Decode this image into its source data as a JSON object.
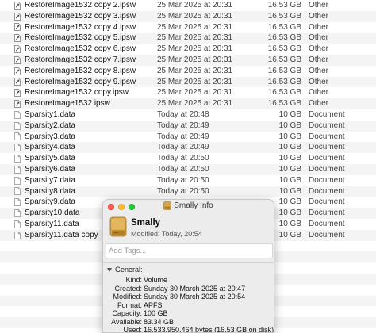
{
  "finder": {
    "rows": [
      {
        "name": "RestoreImage1532 copy 2.ipsw",
        "date": "25 Mar 2025 at 20:31",
        "size": "16.53 GB",
        "kind": "Other",
        "icon": "ipsw-file-icon"
      },
      {
        "name": "RestoreImage1532 copy 3.ipsw",
        "date": "25 Mar 2025 at 20:31",
        "size": "16.53 GB",
        "kind": "Other",
        "icon": "ipsw-file-icon"
      },
      {
        "name": "RestoreImage1532 copy 4.ipsw",
        "date": "25 Mar 2025 at 20:31",
        "size": "16.53 GB",
        "kind": "Other",
        "icon": "ipsw-file-icon"
      },
      {
        "name": "RestoreImage1532 copy 5.ipsw",
        "date": "25 Mar 2025 at 20:31",
        "size": "16.53 GB",
        "kind": "Other",
        "icon": "ipsw-file-icon"
      },
      {
        "name": "RestoreImage1532 copy 6.ipsw",
        "date": "25 Mar 2025 at 20:31",
        "size": "16.53 GB",
        "kind": "Other",
        "icon": "ipsw-file-icon"
      },
      {
        "name": "RestoreImage1532 copy 7.ipsw",
        "date": "25 Mar 2025 at 20:31",
        "size": "16.53 GB",
        "kind": "Other",
        "icon": "ipsw-file-icon"
      },
      {
        "name": "RestoreImage1532 copy 8.ipsw",
        "date": "25 Mar 2025 at 20:31",
        "size": "16.53 GB",
        "kind": "Other",
        "icon": "ipsw-file-icon"
      },
      {
        "name": "RestoreImage1532 copy 9.ipsw",
        "date": "25 Mar 2025 at 20:31",
        "size": "16.53 GB",
        "kind": "Other",
        "icon": "ipsw-file-icon"
      },
      {
        "name": "RestoreImage1532 copy.ipsw",
        "date": "25 Mar 2025 at 20:31",
        "size": "16.53 GB",
        "kind": "Other",
        "icon": "ipsw-file-icon"
      },
      {
        "name": "RestoreImage1532.ipsw",
        "date": "25 Mar 2025 at 20:31",
        "size": "16.53 GB",
        "kind": "Other",
        "icon": "ipsw-file-icon"
      },
      {
        "name": "Sparsity1.data",
        "date": "Today at 20:48",
        "size": "10 GB",
        "kind": "Document",
        "icon": "document-icon"
      },
      {
        "name": "Sparsity2.data",
        "date": "Today at 20:49",
        "size": "10 GB",
        "kind": "Document",
        "icon": "document-icon"
      },
      {
        "name": "Sparsity3.data",
        "date": "Today at 20:49",
        "size": "10 GB",
        "kind": "Document",
        "icon": "document-icon"
      },
      {
        "name": "Sparsity4.data",
        "date": "Today at 20:49",
        "size": "10 GB",
        "kind": "Document",
        "icon": "document-icon"
      },
      {
        "name": "Sparsity5.data",
        "date": "Today at 20:50",
        "size": "10 GB",
        "kind": "Document",
        "icon": "document-icon"
      },
      {
        "name": "Sparsity6.data",
        "date": "Today at 20:50",
        "size": "10 GB",
        "kind": "Document",
        "icon": "document-icon"
      },
      {
        "name": "Sparsity7.data",
        "date": "Today at 20:50",
        "size": "10 GB",
        "kind": "Document",
        "icon": "document-icon"
      },
      {
        "name": "Sparsity8.data",
        "date": "Today at 20:50",
        "size": "10 GB",
        "kind": "Document",
        "icon": "document-icon"
      },
      {
        "name": "Sparsity9.data",
        "date": "",
        "size": "10 GB",
        "kind": "Document",
        "icon": "document-icon"
      },
      {
        "name": "Sparsity10.data",
        "date": "",
        "size": "10 GB",
        "kind": "Document",
        "icon": "document-icon"
      },
      {
        "name": "Sparsity11.data",
        "date": "",
        "size": "10 GB",
        "kind": "Document",
        "icon": "document-icon"
      },
      {
        "name": "Sparsity11.data copy",
        "date": "",
        "size": "10 GB",
        "kind": "Document",
        "icon": "document-icon"
      },
      {
        "name": "",
        "date": "",
        "size": "",
        "kind": "",
        "icon": ""
      },
      {
        "name": "",
        "date": "",
        "size": "",
        "kind": "",
        "icon": ""
      },
      {
        "name": "",
        "date": "",
        "size": "",
        "kind": "",
        "icon": ""
      },
      {
        "name": "",
        "date": "",
        "size": "",
        "kind": "",
        "icon": ""
      },
      {
        "name": "",
        "date": "",
        "size": "",
        "kind": "",
        "icon": ""
      },
      {
        "name": "",
        "date": "",
        "size": "",
        "kind": "",
        "icon": ""
      },
      {
        "name": "",
        "date": "",
        "size": "",
        "kind": "",
        "icon": ""
      },
      {
        "name": "",
        "date": "",
        "size": "",
        "kind": "",
        "icon": ""
      },
      {
        "name": "",
        "date": "",
        "size": "",
        "kind": "",
        "icon": ""
      }
    ]
  },
  "info": {
    "window_title": "Smally Info",
    "volume_name": "Smally",
    "modified_line": "Modified: Today, 20:54",
    "tags_placeholder": "Add Tags...",
    "section_general": "General:",
    "fields": [
      {
        "key": "Kind:",
        "value": "Volume"
      },
      {
        "key": "Created:",
        "value": "Sunday 30 March 2025 at 20:47"
      },
      {
        "key": "Modified:",
        "value": "Sunday 30 March 2025 at 20:54"
      },
      {
        "key": "Format:",
        "value": "APFS"
      },
      {
        "key": "Capacity:",
        "value": "100 GB"
      },
      {
        "key": "Available:",
        "value": "83.34 GB"
      },
      {
        "key": "Used:",
        "value": "16,533,950,464 bytes (16.53 GB on disk)"
      }
    ],
    "icons": {
      "title": "external-drive-icon",
      "header": "external-drive-icon"
    },
    "colors": {
      "drive": "#c9953a",
      "close": "#fe5f57",
      "minimize": "#febc2e",
      "zoom": "#28c840"
    }
  }
}
